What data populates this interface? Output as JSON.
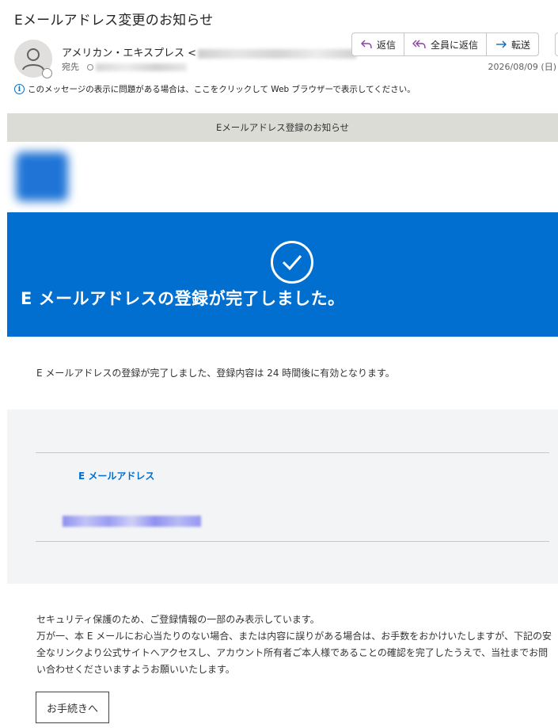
{
  "email": {
    "subject": "Eメールアドレス変更のお知らせ",
    "sender_name": "アメリカン・エキスプレス <",
    "to_label": "宛先",
    "date": "2026/08/09 (日)",
    "info_text": "このメッセージの表示に問題がある場合は、ここをクリックして Web ブラウザーで表示してください。"
  },
  "toolbar": {
    "reply": "返信",
    "reply_all": "全員に返信",
    "forward": "転送"
  },
  "body": {
    "preheader": "Eメールアドレス登録のお知らせ",
    "headline": "E メールアドレスの登録が完了しました。",
    "line1": "E メールアドレスの登録が完了しました、登録内容は 24 時間後に有効となります。",
    "panel_label": "E メールアドレス",
    "notice": [
      "セキュリティ保護のため、ご登録情報の一部のみ表示しています。",
      "万が一、本 E メールにお心当たりのない場合、または内容に誤りがある場合は、お手数をおかけいたしますが、下記の安全なリンクより公式サイトへアクセスし、アカウント所有者ご本人様であることの確認を完了したうえで、当社までお問い合わせくださいますようお願いいたします。"
    ],
    "cta": "お手続きへ"
  },
  "colors": {
    "brand_blue": "#006fcf",
    "preheader_bg": "#dcdcd7",
    "panel_bg": "#f3f4f6"
  },
  "icons": [
    "person-icon",
    "reply-icon",
    "reply-all-icon",
    "forward-icon",
    "info-icon",
    "checkmark-icon"
  ]
}
